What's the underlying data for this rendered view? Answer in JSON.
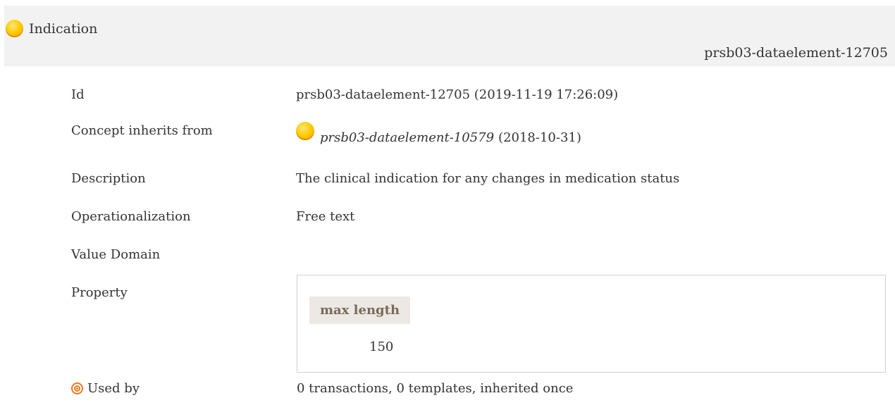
{
  "header": {
    "title": "Indication",
    "identifier": "prsb03-dataelement-12705",
    "icon": "concept-yellow-dot-icon"
  },
  "details": {
    "id": {
      "label": "Id",
      "value": "prsb03-dataelement-12705 (2019-11-19 17:26:09)"
    },
    "inherits": {
      "label": "Concept inherits from",
      "link": "prsb03-dataelement-10579",
      "date": "(2018-10-31)",
      "icon": "concept-yellow-dot-icon"
    },
    "description": {
      "label": "Description",
      "value": "The clinical indication for any changes in medication status"
    },
    "operationalization": {
      "label": "Operationalization",
      "value": "Free text"
    },
    "value_domain": {
      "label": "Value Domain"
    },
    "property": {
      "label": "Property",
      "column_header": "max length",
      "column_value": "150"
    },
    "used_by": {
      "label": "Used by",
      "value": "0 transactions, 0 templates, inherited once",
      "icon": "target-icon"
    }
  },
  "colors": {
    "header_bg": "#f2f2f2",
    "property_header_bg": "#ece8e3",
    "property_header_text": "#7a6a5a",
    "icon_yellow": "#ffcc00",
    "icon_orange": "#f07820"
  }
}
